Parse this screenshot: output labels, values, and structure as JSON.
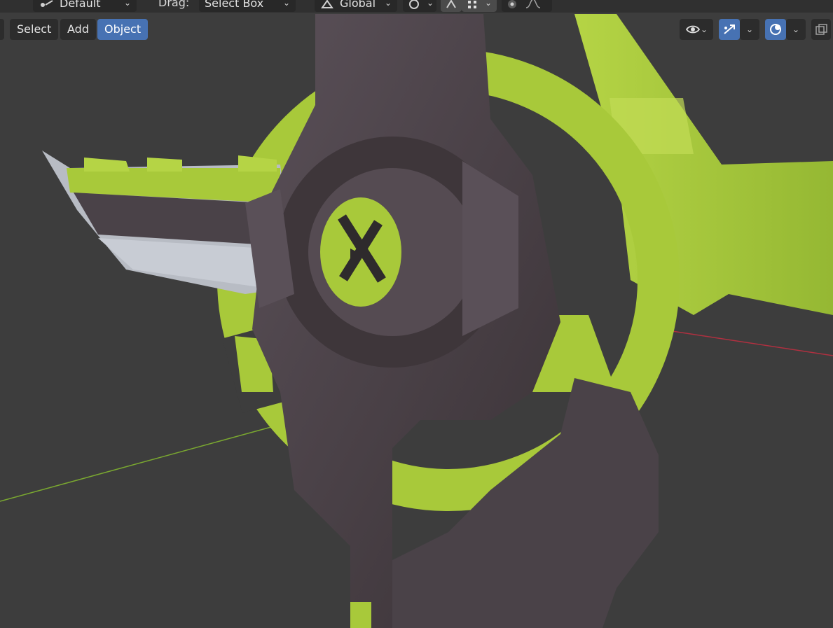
{
  "header": {
    "transform_orientation_label": "Default",
    "drag_label": "Drag:",
    "drag_value": "Select Box",
    "orientation_value": "Global"
  },
  "menu": {
    "items": [
      {
        "label": "Select"
      },
      {
        "label": "Add"
      },
      {
        "label": "Object"
      }
    ]
  },
  "colors": {
    "viewport_bg": "#3d3d3d",
    "lime": "#a8c93a",
    "dark_metal": "#4a4248",
    "silver": "#b8bcc4",
    "accent_blue": "#4772b3",
    "x_axis": "#b03040",
    "y_axis": "#7aa830"
  },
  "icons": [
    "transform-pivot-icon",
    "orientation-icon",
    "snap-icon",
    "proportional-edit-icon",
    "visibility-icon",
    "gizmo-icon",
    "overlay-icon",
    "xray-icon"
  ]
}
